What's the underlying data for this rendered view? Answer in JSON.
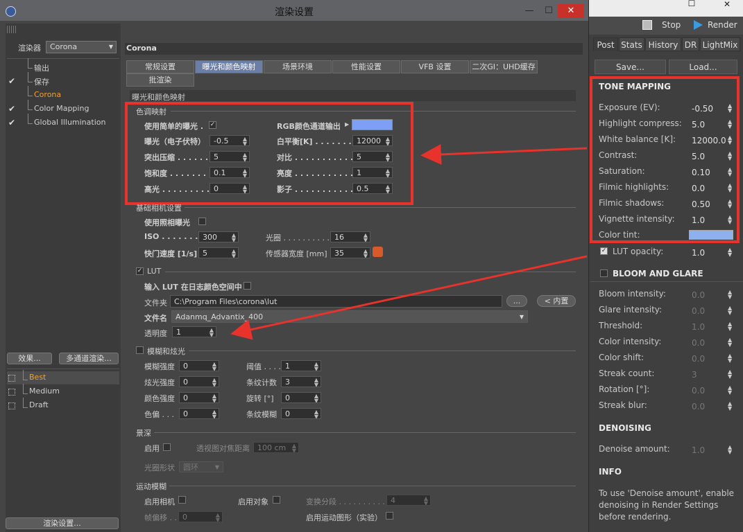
{
  "window": {
    "title": "渲染设置",
    "min": "—",
    "max": "☐",
    "close": "✕"
  },
  "sidebar": {
    "renderer_label": "渲染器",
    "renderer_value": "Corona",
    "tree": [
      {
        "label": "输出",
        "checked": false
      },
      {
        "label": "保存",
        "checked": true
      },
      {
        "label": "Corona",
        "checked": false,
        "active": true
      },
      {
        "label": "Color Mapping",
        "checked": true
      },
      {
        "label": "Global Illumination",
        "checked": true
      }
    ],
    "effects_button": "效果...",
    "multipass_button": "多通道渲染...",
    "presets": [
      {
        "label": "Best",
        "active": true
      },
      {
        "label": "Medium"
      },
      {
        "label": "Draft"
      }
    ],
    "render_settings_button": "渲染设置..."
  },
  "main": {
    "header": "Corona",
    "tabs": [
      {
        "label": "常规设置"
      },
      {
        "label": "曝光和颜色映射",
        "active": true
      },
      {
        "label": "场景环境"
      },
      {
        "label": "性能设置"
      },
      {
        "label": "VFB 设置"
      },
      {
        "label": "二次GI：UHD缓存"
      },
      {
        "label": "批渲染"
      }
    ],
    "section_title": "曝光和颜色映射",
    "tone": {
      "title": "色调映射",
      "simple_exposure_label": "使用简单的曝光 .",
      "simple_exposure_check": "✓",
      "rgb_label": "RGB颜色通道输出",
      "rgb_color": "#7ea0f4",
      "exposure_label": "曝光（电子伏特）",
      "exposure_value": "-0.5",
      "wb_label": "白平衡[K] . . . . . . . . .",
      "wb_value": "12000",
      "hc_label": "突出压缩 . . . . . .",
      "hc_value": "5",
      "contrast_label": "对比 . . . . . . . . . . . .",
      "contrast_value": "5",
      "sat_label": "饱和度 . . . . . . . .",
      "sat_value": "0.1",
      "bright_label": "亮度 . . . . . . . . . . . .",
      "bright_value": "1",
      "high_label": "高光 . . . . . . . . . .",
      "high_value": "0",
      "shadow_label": "影子 . . . . . . . . . . . .",
      "shadow_value": "0.5"
    },
    "camera": {
      "title": "基础相机设置",
      "photo_label": "使用照相曝光",
      "iso_label": "ISO . . . . . . . . . .",
      "iso_value": "300",
      "aperture_label": "光圈 . . . . . . . . . . .",
      "aperture_value": "16",
      "shutter_label": "快门速度 [1/s]",
      "shutter_value": "5",
      "sensor_label": "传感器宽度 [mm]",
      "sensor_value": "35"
    },
    "lut": {
      "title": "LUT",
      "log_label": "输入 LUT 在日志颜色空间中",
      "folder_label": "文件夹",
      "folder_value": "C:\\Program Files\\corona\\lut",
      "browse_button": "...",
      "builtin_button": "< 内置",
      "file_label": "文件名",
      "file_value": "Adanmq_Advantix_400",
      "opacity_label": "透明度",
      "opacity_value": "1"
    },
    "bloom": {
      "title": "模糊和炫光",
      "blur_label": "模糊强度",
      "blur_value": "0",
      "thresh_label": "阈值 . . . .",
      "thresh_value": "1",
      "glare_label": "炫光强度",
      "glare_value": "0",
      "streak_label": "条纹计数",
      "streak_value": "3",
      "color_label": "颜色强度",
      "color_value": "0",
      "rot_label": "旋转 [°]",
      "rot_value": "0",
      "shift_label": "色偏 . . .",
      "shift_value": "0",
      "sblur_label": "条纹模糊",
      "sblur_value": "0"
    },
    "dof": {
      "title": "景深",
      "enable_label": "启用",
      "focus_label": "透视图对焦距离",
      "focus_value": "100 cm",
      "shape_label": "光圈形状",
      "shape_value": "圆环"
    },
    "motion": {
      "title": "运动模糊",
      "cam_label": "启用相机",
      "obj_label": "启用对象",
      "seg_label": "变换分段 . . . . . . . . . . .",
      "seg_value": "4",
      "frame_label": "帧偏移 . .",
      "frame_value": "0",
      "geo_label": "启用运动图形（实验）"
    }
  },
  "vfb": {
    "stop_label": "Stop",
    "render_label": "Render",
    "tabs": [
      "Post",
      "Stats",
      "History",
      "DR",
      "LightMix"
    ],
    "save_button": "Save...",
    "load_button": "Load...",
    "tone_header": "TONE MAPPING",
    "tone": [
      {
        "label": "Exposure (EV):",
        "value": "-0.50"
      },
      {
        "label": "Highlight compress:",
        "value": "5.0"
      },
      {
        "label": "White balance [K]:",
        "value": "12000.0"
      },
      {
        "label": "Contrast:",
        "value": "5.0"
      },
      {
        "label": "Saturation:",
        "value": "0.10"
      },
      {
        "label": "Filmic highlights:",
        "value": "0.0"
      },
      {
        "label": "Filmic shadows:",
        "value": "0.50"
      },
      {
        "label": "Vignette intensity:",
        "value": "1.0"
      }
    ],
    "tint_label": "Color tint:",
    "tint_color": "#8fb0ee",
    "lut_label": "LUT opacity:",
    "lut_value": "1.0",
    "bloom_header": "BLOOM AND GLARE",
    "bloom": [
      {
        "label": "Bloom intensity:",
        "value": "0.0"
      },
      {
        "label": "Glare intensity:",
        "value": "0.0"
      },
      {
        "label": "Threshold:",
        "value": "1.0"
      },
      {
        "label": "Color intensity:",
        "value": "0.0"
      },
      {
        "label": "Color shift:",
        "value": "0.0"
      },
      {
        "label": "Streak count:",
        "value": "3"
      },
      {
        "label": "Rotation [°]:",
        "value": "0.0"
      },
      {
        "label": "Streak blur:",
        "value": "0.0"
      }
    ],
    "denoise_header": "DENOISING",
    "denoise_label": "Denoise amount:",
    "denoise_value": "1.0",
    "info_header": "INFO",
    "info_text": "To use 'Denoise amount', enable denoising in Render Settings before rendering."
  },
  "colors": {
    "annotation": "#e8322c",
    "active_tab": "#6b7ea6"
  }
}
